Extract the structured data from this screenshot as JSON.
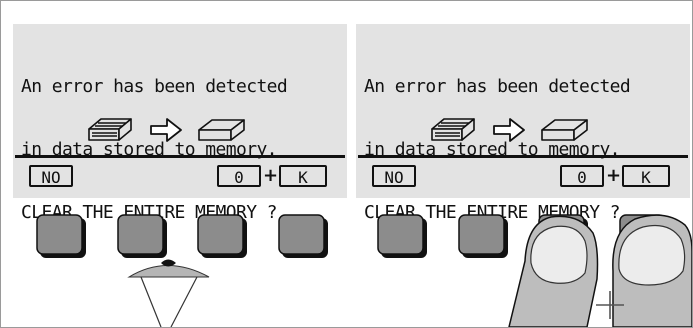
{
  "screens": [
    {
      "message_lines": [
        "An error has been detected",
        "in data stored to memory.",
        "CLEAR THE ENTIRE MEMORY ?"
      ],
      "icon_from": "memory-chip-full-icon",
      "icon_arrow": "arrow-right-icon",
      "icon_to": "memory-chip-empty-icon",
      "softkeys": {
        "left": "NO",
        "right_first": "0",
        "combine": "+",
        "right_second": "K"
      }
    },
    {
      "message_lines": [
        "An error has been detected",
        "in data stored to memory.",
        "CLEAR THE ENTIRE MEMORY ?"
      ],
      "icon_from": "memory-chip-full-icon",
      "icon_arrow": "arrow-right-icon",
      "icon_to": "memory-chip-empty-icon",
      "softkeys": {
        "left": "NO",
        "right_first": "0",
        "combine": "+",
        "right_second": "K"
      }
    }
  ],
  "hardware": {
    "button_count_per_group": 4,
    "left_group_pressed_button": 3,
    "right_group_pressed_buttons": [
      3,
      4
    ],
    "combine_symbol": "+"
  },
  "colors": {
    "panel_bg": "#e3e3e3",
    "button_fill": "#8c8c8c",
    "finger_fill": "#bdbdbd",
    "eye_fill": "#b5b5b5"
  }
}
